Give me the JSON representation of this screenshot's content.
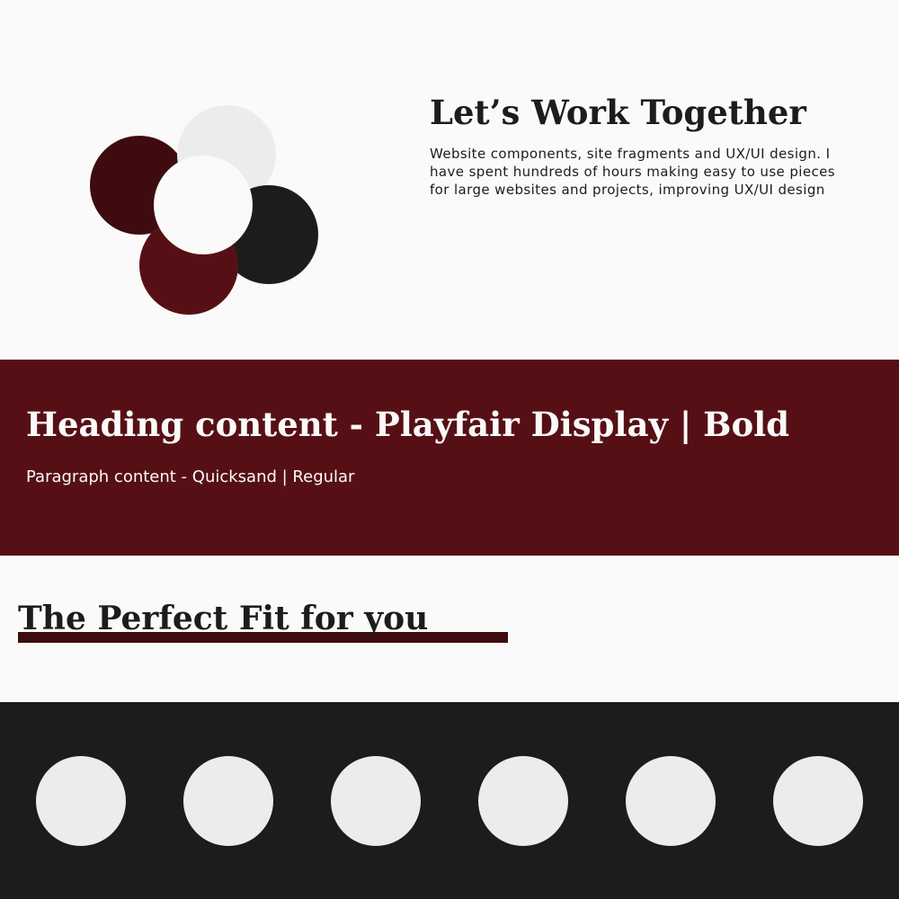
{
  "hero": {
    "title": "Let’s Work Together",
    "description": "Website components, site fragments and UX/UI design. I have spent hundreds of hours making easy to use pieces for large websites and projects, improving UX/UI design"
  },
  "band": {
    "heading": "Heading content - Playfair Display | Bold",
    "paragraph": "Paragraph content - Quicksand | Regular"
  },
  "fit": {
    "title": "The Perfect Fit for you"
  },
  "colors": {
    "background": "#fafafa",
    "maroon": "#561015",
    "maroon_dark": "#3e0c0f",
    "near_black": "#1c1d1a",
    "light_gray": "#ececec"
  }
}
